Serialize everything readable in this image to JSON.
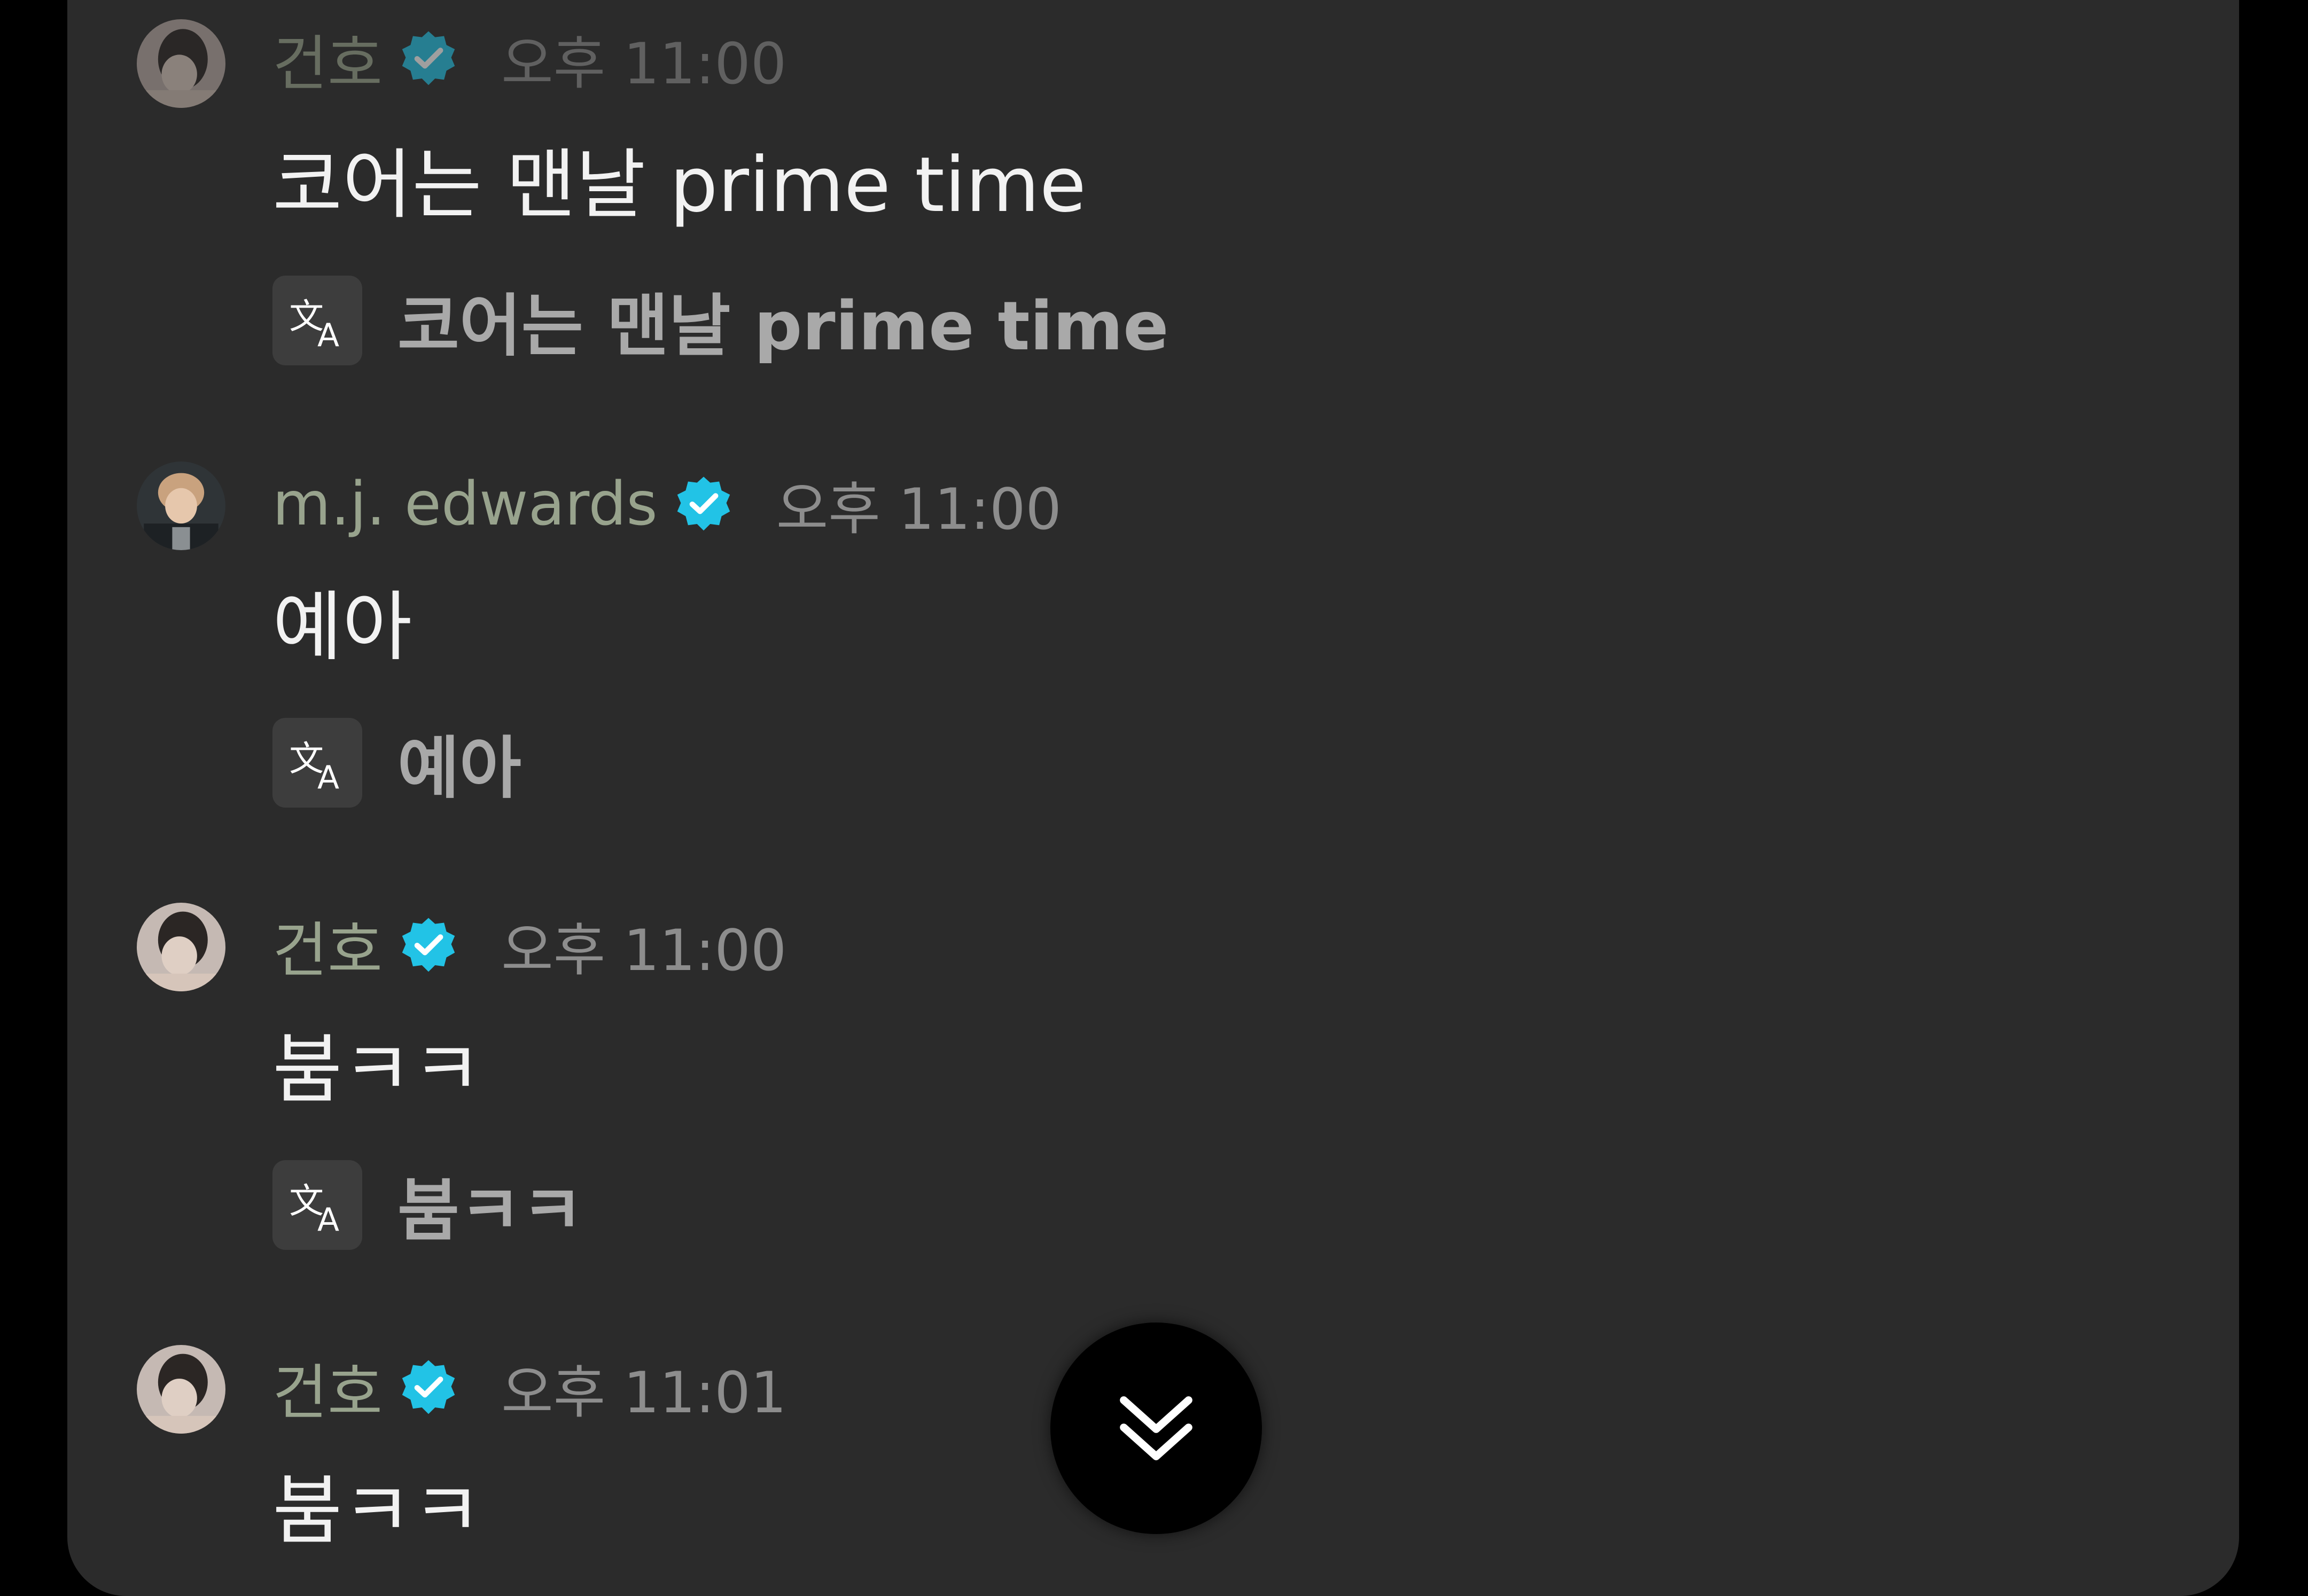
{
  "chat": {
    "messages": [
      {
        "author": "건호",
        "time": "오후 11:00",
        "text": "코어는 맨날 prime time",
        "translation": "코어는 맨날 prime time",
        "verified_icon": "verified-badge-icon",
        "translate_icon": "translate-icon"
      },
      {
        "author": "m.j. edwards",
        "time": "오후 11:00",
        "text": "예아",
        "translation": "예아",
        "verified_icon": "verified-badge-icon",
        "translate_icon": "translate-icon"
      },
      {
        "author": "건호",
        "time": "오후 11:00",
        "text": "붐ㅋㅋ",
        "translation": "붐ㅋㅋ",
        "verified_icon": "verified-badge-icon",
        "translate_icon": "translate-icon"
      },
      {
        "author": "건호",
        "time": "오후 11:01",
        "text": "붐ㅋㅋ",
        "verified_icon": "verified-badge-icon"
      }
    ],
    "scroll_to_bottom_icon": "double-chevron-down-icon"
  },
  "colors": {
    "panel_background": "#2b2b2b",
    "author_name": "#98a38d",
    "timestamp": "#8d8d8d",
    "message_text": "#f2f2f2",
    "translation_text": "#a9a9a9",
    "verified_badge": "#22c3e6"
  }
}
